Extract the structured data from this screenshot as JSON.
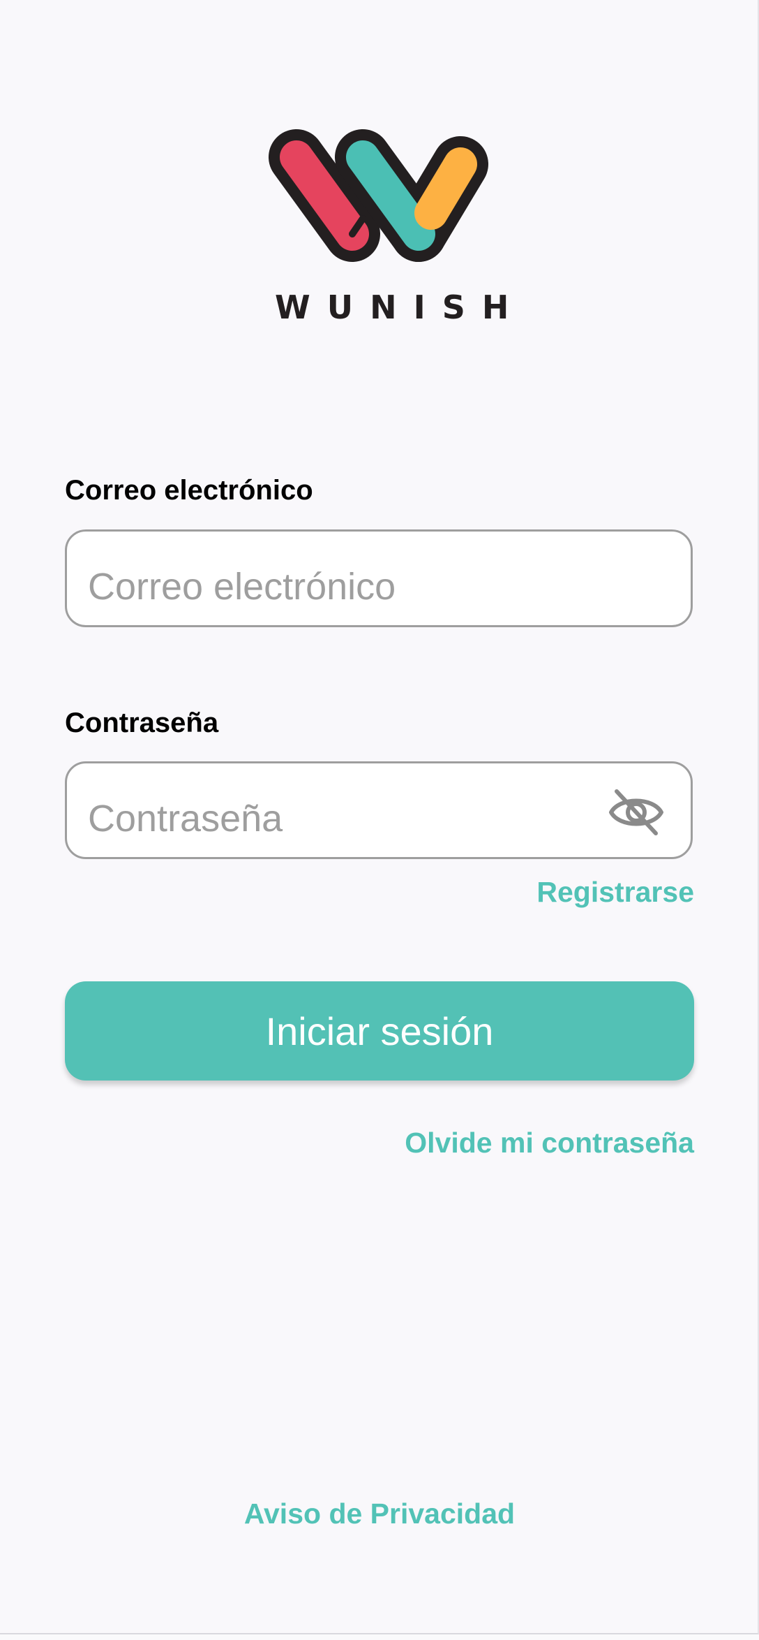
{
  "brand": {
    "name": "WUNISH",
    "colors": {
      "red": "#e5445e",
      "teal": "#4bbfb4",
      "orange": "#fdb143",
      "outline": "#231f20"
    }
  },
  "form": {
    "email": {
      "label": "Correo electrónico",
      "placeholder": "Correo electrónico",
      "value": ""
    },
    "password": {
      "label": "Contraseña",
      "placeholder": "Contraseña",
      "value": "",
      "visibility_icon": "eye-off-icon"
    },
    "register_link": "Registrarse",
    "submit_label": "Iniciar sesión",
    "forgot_link": "Olvide mi contraseña"
  },
  "footer": {
    "privacy_link": "Aviso de Privacidad"
  },
  "theme": {
    "accent": "#52c2b6",
    "background": "#f9f8fb"
  }
}
